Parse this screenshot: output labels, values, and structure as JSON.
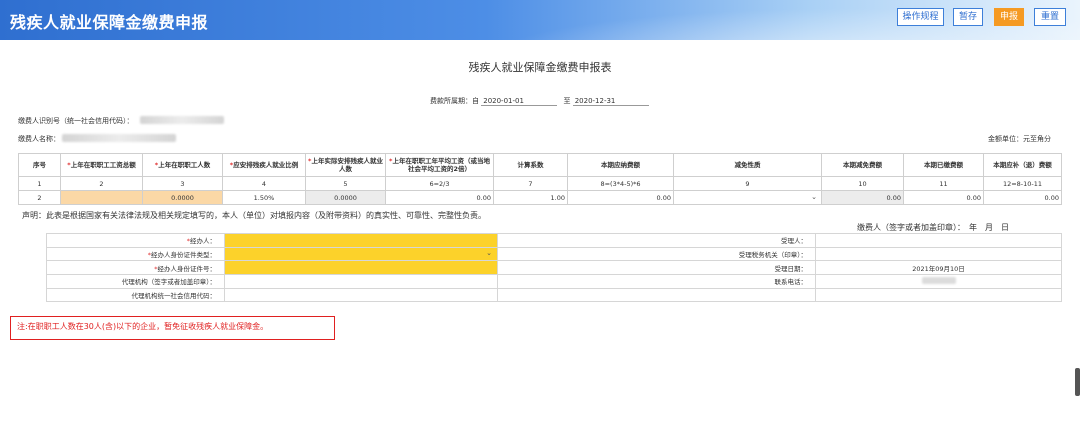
{
  "header": {
    "title": "残疾人就业保障金缴费申报",
    "buttons": {
      "guide": "操作规程",
      "save": "暂存",
      "submit": "申报",
      "reset": "重置"
    }
  },
  "form": {
    "title": "残疾人就业保障金缴费申报表",
    "period_label": "费款所属期：自",
    "period_start": "2020-01-01",
    "period_to": "至",
    "period_end": "2020-12-31",
    "payer_id_label": "缴费人识别号（统一社会信用代码）：",
    "payer_name_label": "缴费人名称：",
    "unit_label": "金额单位：元至角分"
  },
  "table": {
    "headers": [
      {
        "text": "序号",
        "req": false
      },
      {
        "text": "上年在职职工工资总额",
        "req": true
      },
      {
        "text": "上年在职职工人数",
        "req": true
      },
      {
        "text": "应安排残疾人就业比例",
        "req": true
      },
      {
        "text": "上年实际安排残疾人就业人数",
        "req": true
      },
      {
        "text": "上年在职职工年平均工资（或当地社会平均工资的2倍）",
        "req": true
      },
      {
        "text": "计算系数",
        "req": false
      },
      {
        "text": "本期应纳费额",
        "req": false
      },
      {
        "text": "减免性质",
        "req": false
      },
      {
        "text": "本期减免费额",
        "req": false
      },
      {
        "text": "本期已缴费额",
        "req": false
      },
      {
        "text": "本期应补（退）费额",
        "req": false
      }
    ],
    "index_row": [
      "1",
      "2",
      "3",
      "4",
      "5",
      "6=2/3",
      "7",
      "8=(3*4-5)*6",
      "9",
      "10",
      "11",
      "12=8-10-11"
    ],
    "data_row": [
      "2",
      "",
      "0.0000",
      "1.50%",
      "0.0000",
      "0.00",
      "1.00",
      "0.00",
      "",
      "0.00",
      "0.00",
      "0.00"
    ]
  },
  "declaration": "声明：此表是根据国家有关法律法规及相关规定填写的，本人（单位）对填报内容（及附带资料）的真实性、可靠性、完整性负责。",
  "signature": "缴费人（签字或者加盖印章）：　年　月　日",
  "agent": {
    "handler_label": "经办人：",
    "id_type_label": "经办人身份证件类型：",
    "id_no_label": "经办人身份证件号：",
    "agency_label": "代理机构（签字或者加盖印章）：",
    "agency_code_label": "代理机构统一社会信用代码：",
    "receiver_label": "受理人：",
    "tax_office_label": "受理税务机关（印章）：",
    "receive_date_label": "受理日期：",
    "receive_date": "2021年09月10日",
    "phone_label": "联系电话："
  },
  "note": "注:在职职工人数在30人(含)以下的企业，暂免征收残疾人就业保障金。"
}
